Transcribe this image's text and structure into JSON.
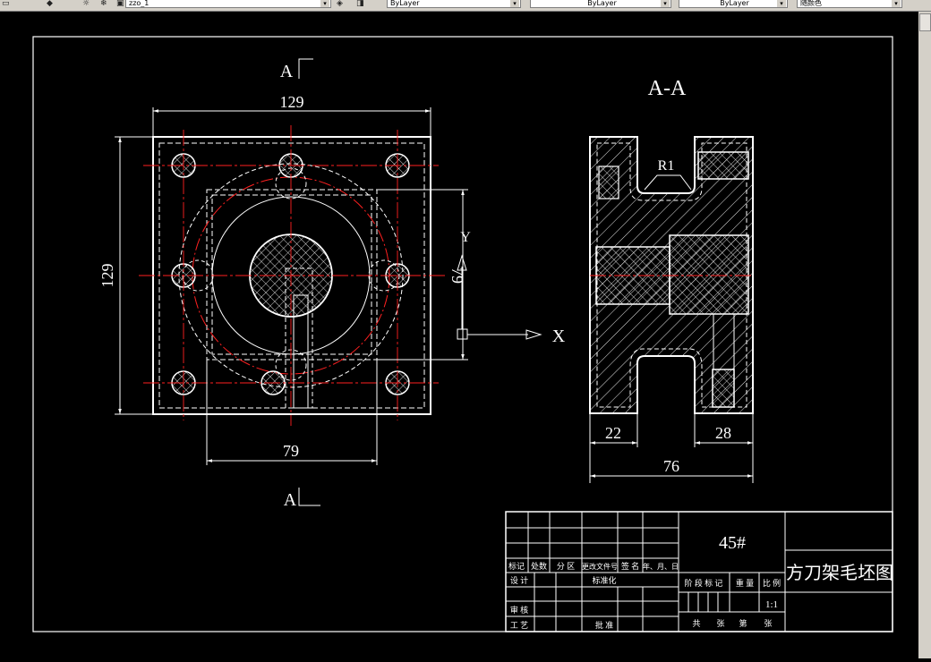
{
  "toolbar": {
    "layer_value": "zzo_1",
    "color_value": "ByLayer",
    "linetype_value": "ByLayer",
    "lineweight_value": "ByLayer",
    "plotstyle_value": "随颜色"
  },
  "drawing": {
    "section_marker": "A",
    "section_view_title": "A-A",
    "dims": {
      "top_width": "129",
      "left_height": "129",
      "inner_width": "79",
      "inner_height": "79",
      "radius": "R1",
      "left_thickness": "22",
      "right_thickness": "28",
      "overall_length": "76"
    },
    "axis_x": "X",
    "axis_y": "Y"
  },
  "title_block": {
    "material": "45#",
    "part_name": "方刀架毛坯图",
    "scale": "1:1",
    "labels": {
      "mark": "标记",
      "count": "处数",
      "zone": "分 区",
      "change_doc": "更改文件号",
      "signature": "签 名",
      "date": "年、月、日",
      "design": "设 计",
      "standardize": "标准化",
      "stage_mark": "阶 段 标 记",
      "weight": "重 量",
      "ratio": "比 例",
      "review": "审 核",
      "process": "工 艺",
      "approve": "批 准",
      "total": "共",
      "sheets": "张",
      "sheet_no": "第",
      "sheet": "张"
    }
  },
  "colors": {
    "background": "#000000",
    "outline": "#ffffff",
    "centerline": "#ff2020",
    "hatch": "#ffffff",
    "toolbar": "#d4d0c8"
  }
}
